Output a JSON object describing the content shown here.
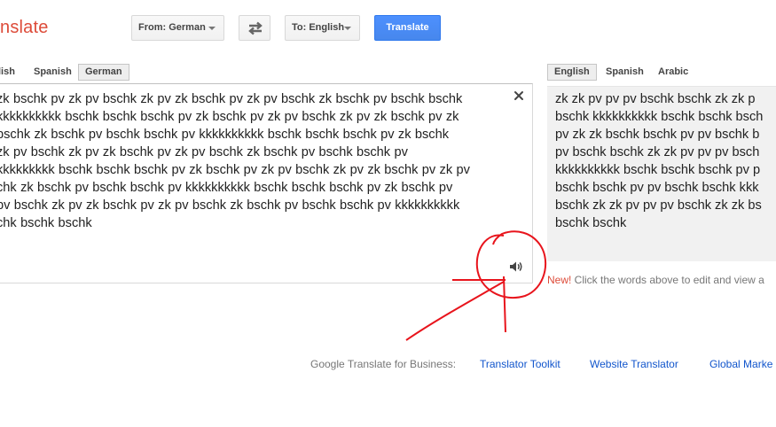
{
  "header": {
    "logo_text": "nslate",
    "from_label": "From: German",
    "to_label": "To: English",
    "translate_label": "Translate"
  },
  "source_tabs": [
    "lish",
    "Spanish",
    "German"
  ],
  "target_tabs": [
    "English",
    "Spanish",
    "Arabic"
  ],
  "source_text": "zk bschk pv zk pv bschk zk pv zk bschk pv zk pv bschk zk bschk pv bschk bschk\nkkkkkkkkkk bschk bschk bschk pv zk bschk pv zk pv bschk zk pv zk bschk pv zk\nbschk zk bschk pv bschk bschk pv kkkkkkkkkk bschk bschk bschk pv zk bschk\nzk pv bschk zk pv zk bschk pv zk pv bschk zk bschk pv bschk bschk pv\nkkkkkkkkk bschk bschk bschk pv zk bschk pv zk pv bschk zk pv zk bschk pv zk pv\nchk zk bschk pv bschk bschk pv kkkkkkkkkk bschk bschk bschk pv zk bschk pv\npv bschk zk pv zk bschk pv zk pv bschk zk bschk pv bschk bschk pv kkkkkkkkkk\nchk bschk bschk",
  "result_text": "zk zk pv pv pv bschk bschk zk zk p\nbschk kkkkkkkkkk bschk bschk bsch\npv zk zk bschk bschk pv pv bschk b\npv bschk bschk zk zk pv pv pv bsch\nkkkkkkkkkk bschk bschk bschk pv p\nbschk bschk pv pv bschk bschk kkk\nbschk zk zk pv pv pv bschk zk zk bs\nbschk bschk",
  "hint": {
    "new_label": "New!",
    "text": " Click the words above to edit and view a"
  },
  "business": {
    "label": "Google Translate for Business:",
    "links": [
      "Translator Toolkit",
      "Website Translator",
      "Global Marke"
    ]
  },
  "colors": {
    "accent_blue": "#4d90fe",
    "logo_red": "#dd4b39",
    "link_blue": "#1155cc",
    "annotation_red": "#e8141c"
  },
  "icons": [
    "swap-arrows-icon",
    "clear-icon",
    "speaker-icon"
  ]
}
